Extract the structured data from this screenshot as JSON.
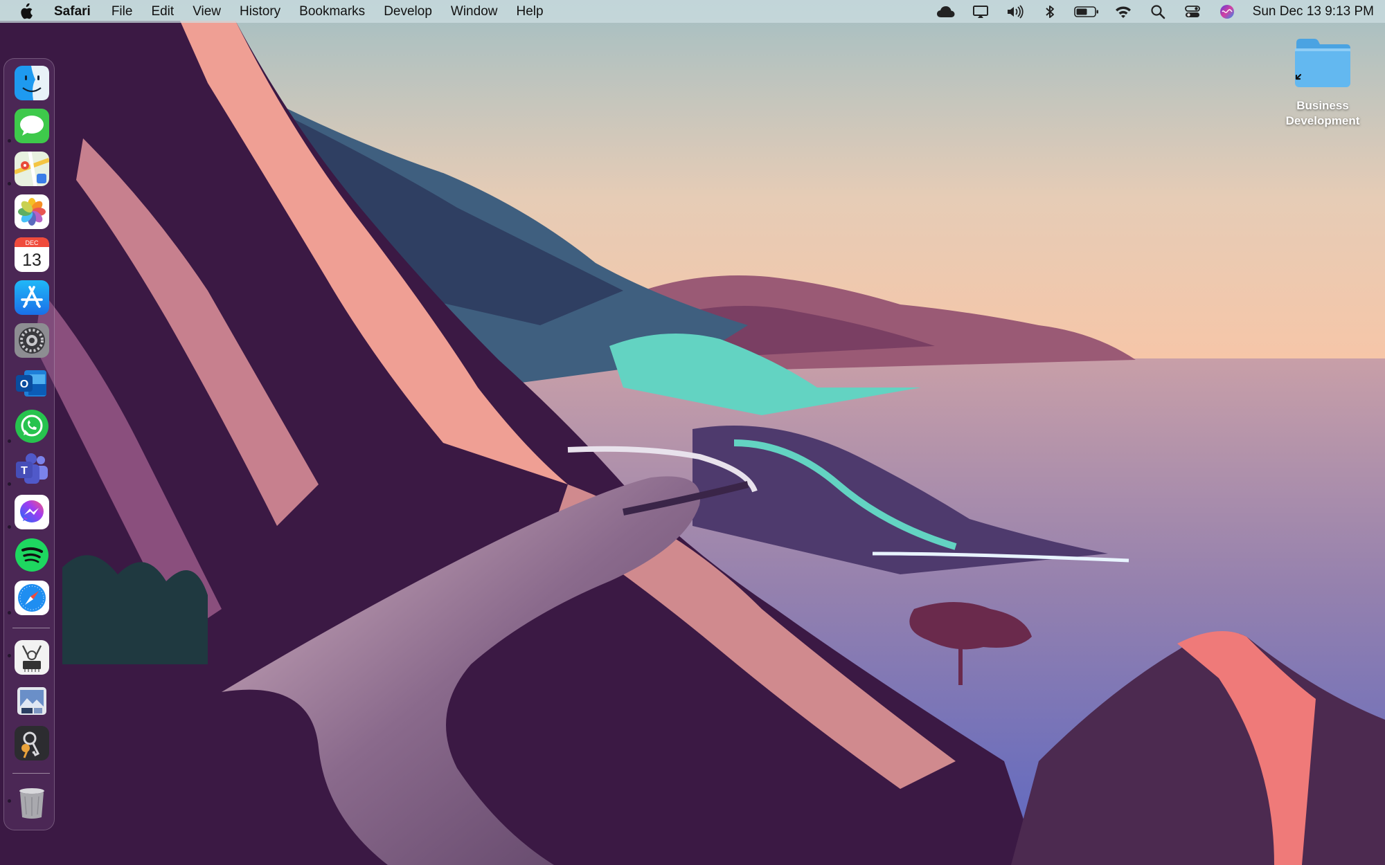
{
  "menubar": {
    "apple_icon": "apple-logo-icon",
    "app_name": "Safari",
    "menus": [
      "File",
      "Edit",
      "View",
      "History",
      "Bookmarks",
      "Develop",
      "Window",
      "Help"
    ],
    "status_icons": [
      "creative-cloud-icon",
      "airplay-display-icon",
      "volume-icon",
      "bluetooth-icon",
      "battery-icon",
      "wifi-icon",
      "spotlight-search-icon",
      "control-center-icon",
      "siri-icon"
    ],
    "clock": "Sun Dec 13  9:13 PM"
  },
  "desktop": {
    "folder_label": "Business Development",
    "folder_color": "#5fb6ee"
  },
  "dock": {
    "apps": [
      {
        "name": "finder",
        "icon": "finder-icon",
        "running": true
      },
      {
        "name": "messages",
        "icon": "messages-icon",
        "running": true
      },
      {
        "name": "maps",
        "icon": "maps-icon",
        "running": false
      },
      {
        "name": "photos",
        "icon": "photos-icon",
        "running": false
      },
      {
        "name": "calendar",
        "icon": "calendar-icon",
        "running": false,
        "month": "DEC",
        "day": "13"
      },
      {
        "name": "app-store",
        "icon": "app-store-icon",
        "running": false
      },
      {
        "name": "system-preferences",
        "icon": "system-preferences-icon",
        "running": false
      },
      {
        "name": "outlook",
        "icon": "outlook-icon",
        "running": true
      },
      {
        "name": "whatsapp",
        "icon": "whatsapp-icon",
        "running": true
      },
      {
        "name": "teams",
        "icon": "teams-icon",
        "running": true
      },
      {
        "name": "messenger",
        "icon": "messenger-icon",
        "running": false
      },
      {
        "name": "spotify",
        "icon": "spotify-icon",
        "running": true
      },
      {
        "name": "safari",
        "icon": "safari-icon",
        "running": true
      },
      {
        "name": "system-information",
        "icon": "system-information-icon",
        "running": false
      },
      {
        "name": "preview",
        "icon": "preview-icon",
        "running": false
      },
      {
        "name": "keychain-access",
        "icon": "keychain-access-icon",
        "running": true
      },
      {
        "name": "trash",
        "icon": "trash-icon",
        "running": false
      }
    ]
  },
  "colors": {
    "sky_top": "#a9c1c4",
    "sky_horizon": "#f3c7ad",
    "sea": "#8d79b2",
    "cliff_dark": "#3d1a45",
    "cliff_light": "#ef9f94",
    "teal_surf": "#63d3c2"
  }
}
